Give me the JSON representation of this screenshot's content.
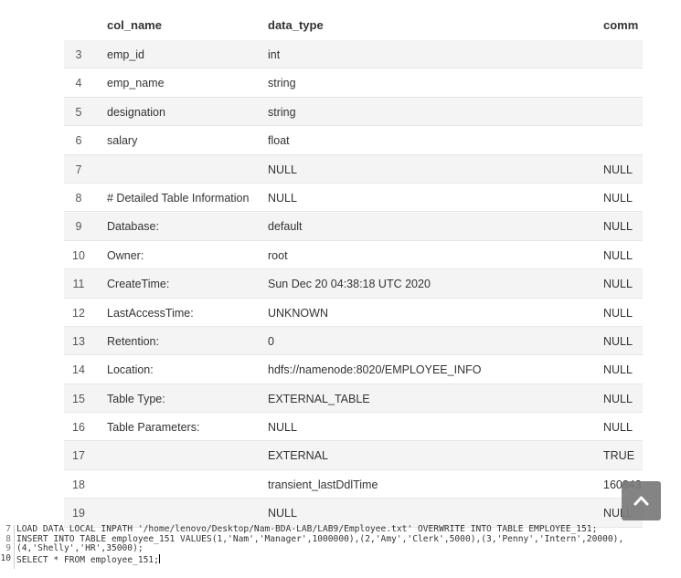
{
  "table": {
    "headers": {
      "index": "",
      "col_name": "col_name",
      "data_type": "data_type",
      "comment": "comm"
    },
    "rows": [
      {
        "idx": "3",
        "col_name": "emp_id",
        "data_type": "int",
        "comment": ""
      },
      {
        "idx": "4",
        "col_name": "emp_name",
        "data_type": "string",
        "comment": ""
      },
      {
        "idx": "5",
        "col_name": "designation",
        "data_type": "string",
        "comment": ""
      },
      {
        "idx": "6",
        "col_name": "salary",
        "data_type": "float",
        "comment": ""
      },
      {
        "idx": "7",
        "col_name": "",
        "data_type": "NULL",
        "comment": "NULL"
      },
      {
        "idx": "8",
        "col_name": "# Detailed Table Information",
        "data_type": "NULL",
        "comment": "NULL"
      },
      {
        "idx": "9",
        "col_name": "Database:",
        "data_type": "default",
        "comment": "NULL"
      },
      {
        "idx": "10",
        "col_name": "Owner:",
        "data_type": "root",
        "comment": "NULL"
      },
      {
        "idx": "11",
        "col_name": "CreateTime:",
        "data_type": "Sun Dec 20 04:38:18 UTC 2020",
        "comment": "NULL"
      },
      {
        "idx": "12",
        "col_name": "LastAccessTime:",
        "data_type": "UNKNOWN",
        "comment": "NULL"
      },
      {
        "idx": "13",
        "col_name": "Retention:",
        "data_type": "0",
        "comment": "NULL"
      },
      {
        "idx": "14",
        "col_name": "Location:",
        "data_type": "hdfs://namenode:8020/EMPLOYEE_INFO",
        "comment": "NULL"
      },
      {
        "idx": "15",
        "col_name": "Table Type:",
        "data_type": "EXTERNAL_TABLE",
        "comment": "NULL"
      },
      {
        "idx": "16",
        "col_name": "Table Parameters:",
        "data_type": "NULL",
        "comment": "NULL"
      },
      {
        "idx": "17",
        "col_name": "",
        "data_type": "EXTERNAL",
        "comment": "TRUE"
      },
      {
        "idx": "18",
        "col_name": "",
        "data_type": "transient_lastDdlTime",
        "comment": "160843"
      },
      {
        "idx": "19",
        "col_name": "",
        "data_type": "NULL",
        "comment": "NULL"
      }
    ]
  },
  "scroll_top_button": {
    "icon": "chevron-up-icon"
  },
  "editor": {
    "lines": [
      {
        "num": "7",
        "text": "LOAD DATA LOCAL INPATH '/home/lenovo/Desktop/Nam-BDA-LAB/LAB9/Employee.txt' OVERWRITE INTO TABLE EMPLOYEE_151;"
      },
      {
        "num": "8",
        "text": "INSERT INTO TABLE employee_151 VALUES(1,'Nam','Manager',1000000),(2,'Amy','Clerk',5000),(3,'Penny','Intern',20000),"
      },
      {
        "num": "9",
        "text": "(4,'Shelly','HR',35000);"
      },
      {
        "num": "10",
        "text": "SELECT * FROM employee_151;"
      }
    ]
  }
}
